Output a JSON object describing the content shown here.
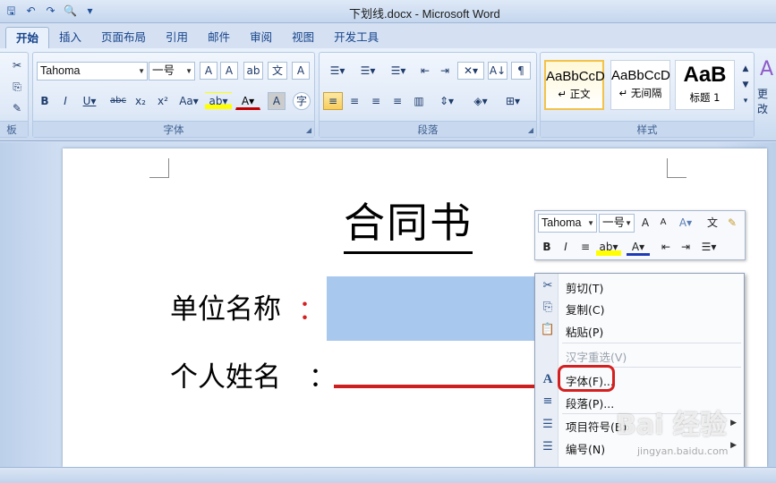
{
  "window": {
    "title": "下划线.docx - Microsoft Word"
  },
  "qat": [
    {
      "icon": "save-icon",
      "glyph": "🖫"
    },
    {
      "icon": "undo-icon",
      "glyph": "↶"
    },
    {
      "icon": "redo-icon",
      "glyph": "↷"
    },
    {
      "icon": "print-preview-icon",
      "glyph": "🔍"
    },
    {
      "icon": "customize-qat-icon",
      "glyph": "▾"
    }
  ],
  "tabs": [
    "开始",
    "插入",
    "页面布局",
    "引用",
    "邮件",
    "审阅",
    "视图",
    "开发工具"
  ],
  "ribbon": {
    "font_group_label": "字体",
    "paragraph_group_label": "段落",
    "styles_group_label": "样式",
    "clipboard_group_label": "板",
    "font_name": "Tahoma",
    "font_size": "一号",
    "styles": [
      {
        "sample": "AaBbCcD",
        "name": "↵ 正文"
      },
      {
        "sample": "AaBbCcD",
        "name": "↵ 无间隔"
      },
      {
        "sample": "AaB",
        "name": "标题 1"
      }
    ],
    "change_styles_label": "更改"
  },
  "document": {
    "title": "合同书",
    "field1_label": "单位名称",
    "field1_colon": "：",
    "field2_label": "个人姓名",
    "field2_colon": "："
  },
  "mini_toolbar": {
    "font_name": "Tahoma",
    "font_size": "一号"
  },
  "context_menu": {
    "items": [
      {
        "icon": "scissors-icon",
        "glyph": "✂",
        "label": "剪切(T)",
        "disabled": false
      },
      {
        "icon": "copy-icon",
        "glyph": "⎘",
        "label": "复制(C)",
        "disabled": false
      },
      {
        "icon": "paste-icon",
        "glyph": "📋",
        "label": "粘贴(P)",
        "disabled": false
      },
      {
        "icon": "none",
        "glyph": "",
        "label": "汉字重选(V)",
        "disabled": true
      },
      {
        "icon": "font-icon",
        "glyph": "A",
        "label": "字体(F)...",
        "disabled": false
      },
      {
        "icon": "paragraph-icon",
        "glyph": "≡",
        "label": "段落(P)...",
        "disabled": false
      },
      {
        "icon": "bullets-icon",
        "glyph": "☰",
        "label": "项目符号(B)",
        "disabled": false
      },
      {
        "icon": "numbering-icon",
        "glyph": "☰",
        "label": "编号(N)",
        "disabled": false
      }
    ]
  },
  "watermark": {
    "text": "Bai 经验",
    "sub": "jingyan.baidu.com"
  },
  "colors": {
    "selection": "#a9c8ee",
    "underline_red": "#cc1f1f",
    "highlight_box": "#d42020",
    "red_colon": "#d42020"
  }
}
